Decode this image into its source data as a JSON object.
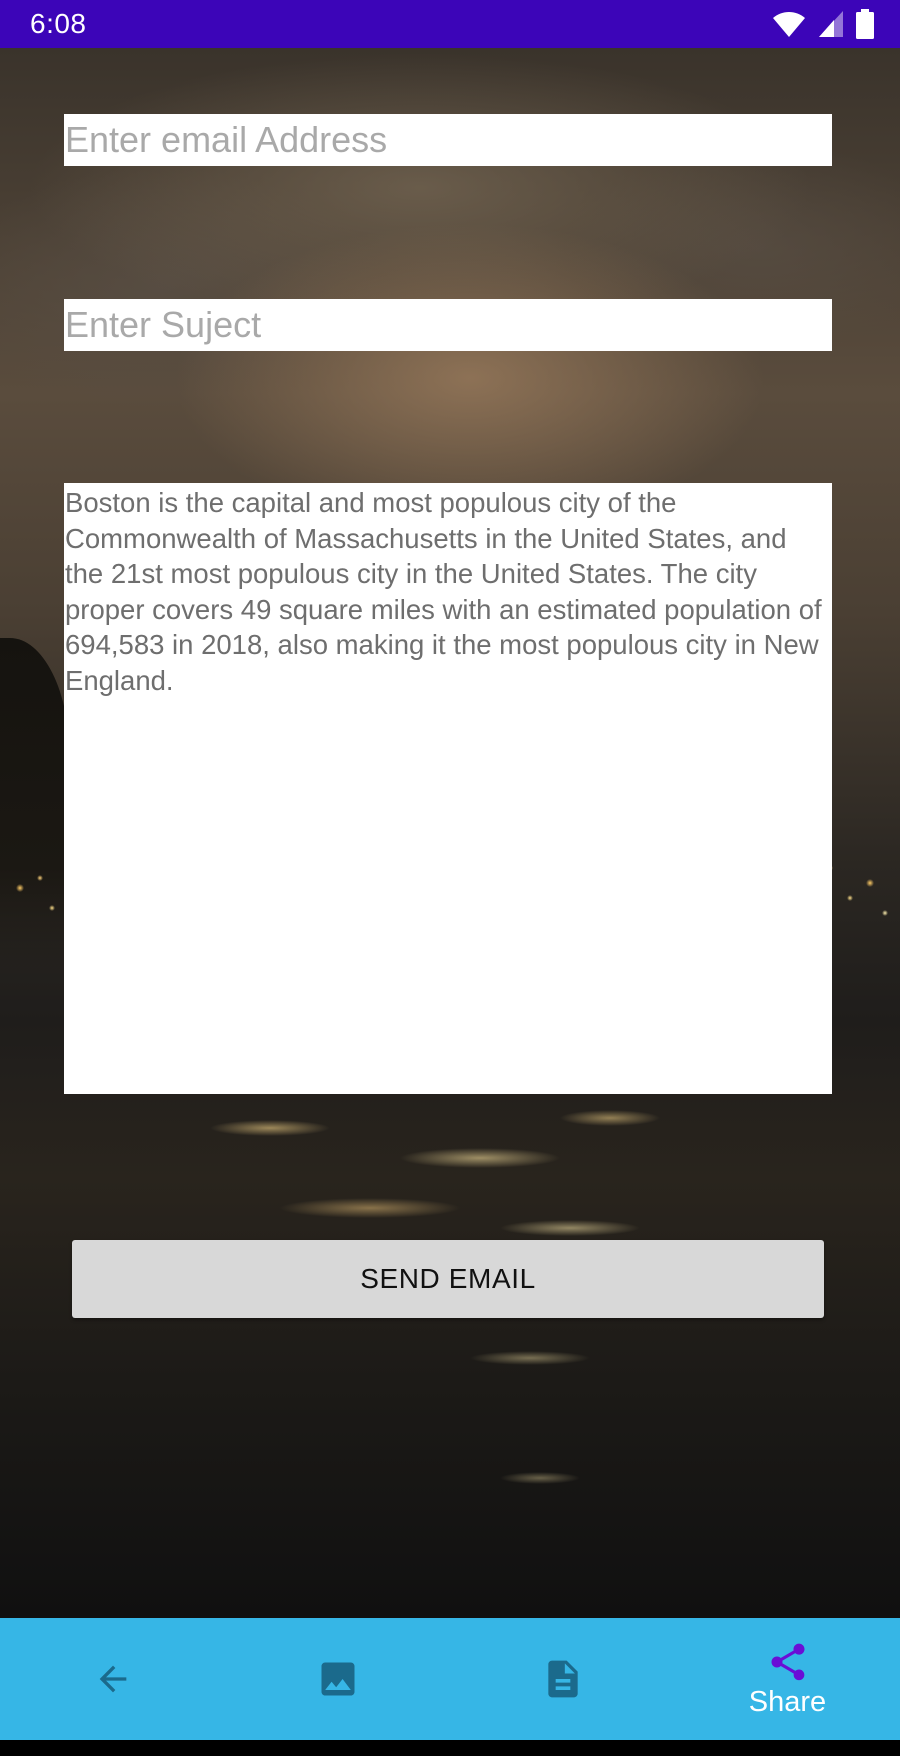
{
  "status_bar": {
    "time": "6:08",
    "icons": [
      "wifi-icon",
      "signal-icon",
      "battery-icon"
    ]
  },
  "form": {
    "email_placeholder": "Enter email Address",
    "email_value": "",
    "subject_placeholder": "Enter Suject",
    "subject_value": "",
    "body_value": "Boston is the capital and most populous city of the Commonwealth of Massachusetts in the United States, and the 21st most populous city in the United States. The city proper covers 49 square miles with an estimated population of 694,583 in 2018, also making it the most populous city in New England.",
    "send_label": "SEND EMAIL"
  },
  "bottom_nav": {
    "items": [
      {
        "icon": "arrow-back-icon",
        "label": ""
      },
      {
        "icon": "image-icon",
        "label": ""
      },
      {
        "icon": "document-icon",
        "label": ""
      },
      {
        "icon": "share-icon",
        "label": "Share"
      }
    ],
    "selected_index": 3
  },
  "colors": {
    "status_bar": "#3c05b8",
    "nav_background": "#36b6e6",
    "nav_icon": "#1b6a8c",
    "nav_selected_icon": "#6a0ed6",
    "button_background": "#d8d8d8"
  }
}
